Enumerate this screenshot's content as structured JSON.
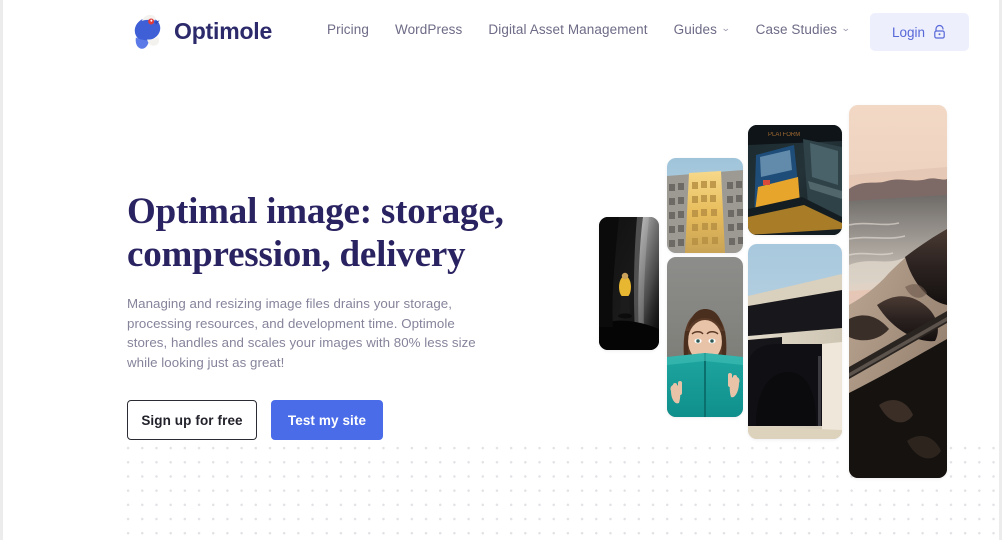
{
  "brand": {
    "name": "Optimole",
    "logo_icon": "optimole-bird-logo",
    "logo_color": "#3a5bd9",
    "text_color": "#2c2a6b"
  },
  "nav": {
    "items": [
      {
        "label": "Pricing",
        "has_dropdown": false
      },
      {
        "label": "WordPress",
        "has_dropdown": false
      },
      {
        "label": "Digital Asset Management",
        "has_dropdown": false
      },
      {
        "label": "Guides",
        "has_dropdown": true,
        "caret": "⌄"
      },
      {
        "label": "Case Studies",
        "has_dropdown": true,
        "caret": "⌄"
      }
    ]
  },
  "login": {
    "label": "Login",
    "icon": "lock-icon",
    "background": "#edeffd",
    "text_color": "#5768d8"
  },
  "hero": {
    "headline_line1": "Optimal image: storage,",
    "headline_line2": "compression, delivery",
    "headline_color": "#2a2361",
    "paragraph": "Managing and resizing image files drains your storage, processing resources, and development time. Optimole stores, handles and scales your images with 80% less size while looking just as great!",
    "paragraph_color": "#86849b",
    "cta_primary": "Test my site",
    "cta_secondary": "Sign up for free",
    "primary_color": "#4a6ce8"
  },
  "collage": {
    "images": [
      {
        "name": "cave-explorer-photo",
        "alt": "Person in yellow jacket inside dark cave"
      },
      {
        "name": "building-facade-photo",
        "alt": "Sunlit building facade against blue sky"
      },
      {
        "name": "subway-train-photo",
        "alt": "Yellow and blue train at dark station"
      },
      {
        "name": "woman-reading-photo",
        "alt": "Woman holding teal book covering her face"
      },
      {
        "name": "architecture-photo",
        "alt": "Minimal beige architecture with dark archway"
      },
      {
        "name": "coastal-sunset-photo",
        "alt": "Rocky coastline at sunset with peach sky"
      }
    ]
  },
  "background": {
    "dot_grid_color": "#e2e2e6",
    "page_color": "#ffffff"
  }
}
